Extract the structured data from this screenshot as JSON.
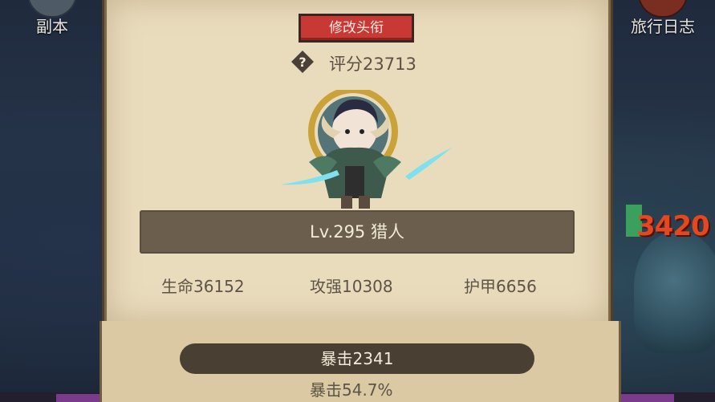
{
  "top_menu": {
    "left_label": "副本",
    "right_label": "旅行日志"
  },
  "background": {
    "damage_number": "3420"
  },
  "panel": {
    "title_button": "修改头衔",
    "score": "评分23713",
    "level_class": "Lv.295 猎人",
    "stats": {
      "hp": "生命36152",
      "attack": "攻强10308",
      "armor": "护甲6656"
    },
    "crit_value": "暴击2341",
    "crit_percent": "暴击54.7%"
  },
  "colors": {
    "parchment": "#e9dcbd",
    "title_button": "#c83935",
    "level_bar": "#6b5e4d",
    "damage_text": "#e34820"
  },
  "icons": [
    "help-icon",
    "dungeon-icon",
    "travel-log-icon"
  ]
}
